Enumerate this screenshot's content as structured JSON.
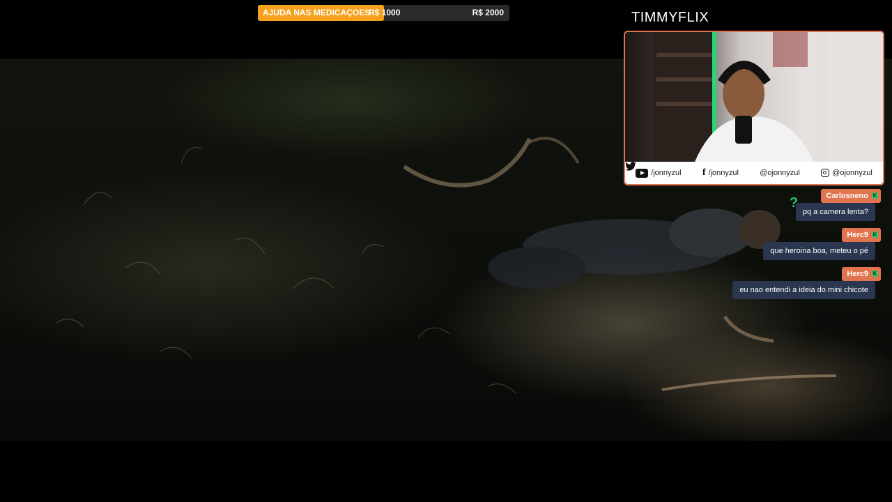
{
  "goal": {
    "title": "AJUDA NAS MEDICAÇOES",
    "current": "R$ 1000",
    "target": "R$ 2000",
    "progress": 0.5,
    "fill_color": "#f5a11e"
  },
  "channel": {
    "title": "TIMMYFLIX"
  },
  "social": {
    "youtube": "/jonnyzul",
    "facebook": "/jonnyzul",
    "twitter": "@ojonnyzul",
    "instagram": "@ojonnyzul"
  },
  "chat": [
    {
      "user": "Carlosneno",
      "message": "pq a camera lenta?"
    },
    {
      "user": "Herc9",
      "message": "que heroina boa, meteu o pé"
    },
    {
      "user": "Herc9",
      "message": "eu nao entendi a ideia do mini chicote"
    }
  ],
  "colors": {
    "accent": "#e2734f",
    "chat_bg": "#2b3650",
    "badge": "#3ec26b"
  },
  "icons": [
    "youtube-icon",
    "facebook-icon",
    "twitter-icon",
    "instagram-icon",
    "question-icon",
    "badge-icon"
  ]
}
